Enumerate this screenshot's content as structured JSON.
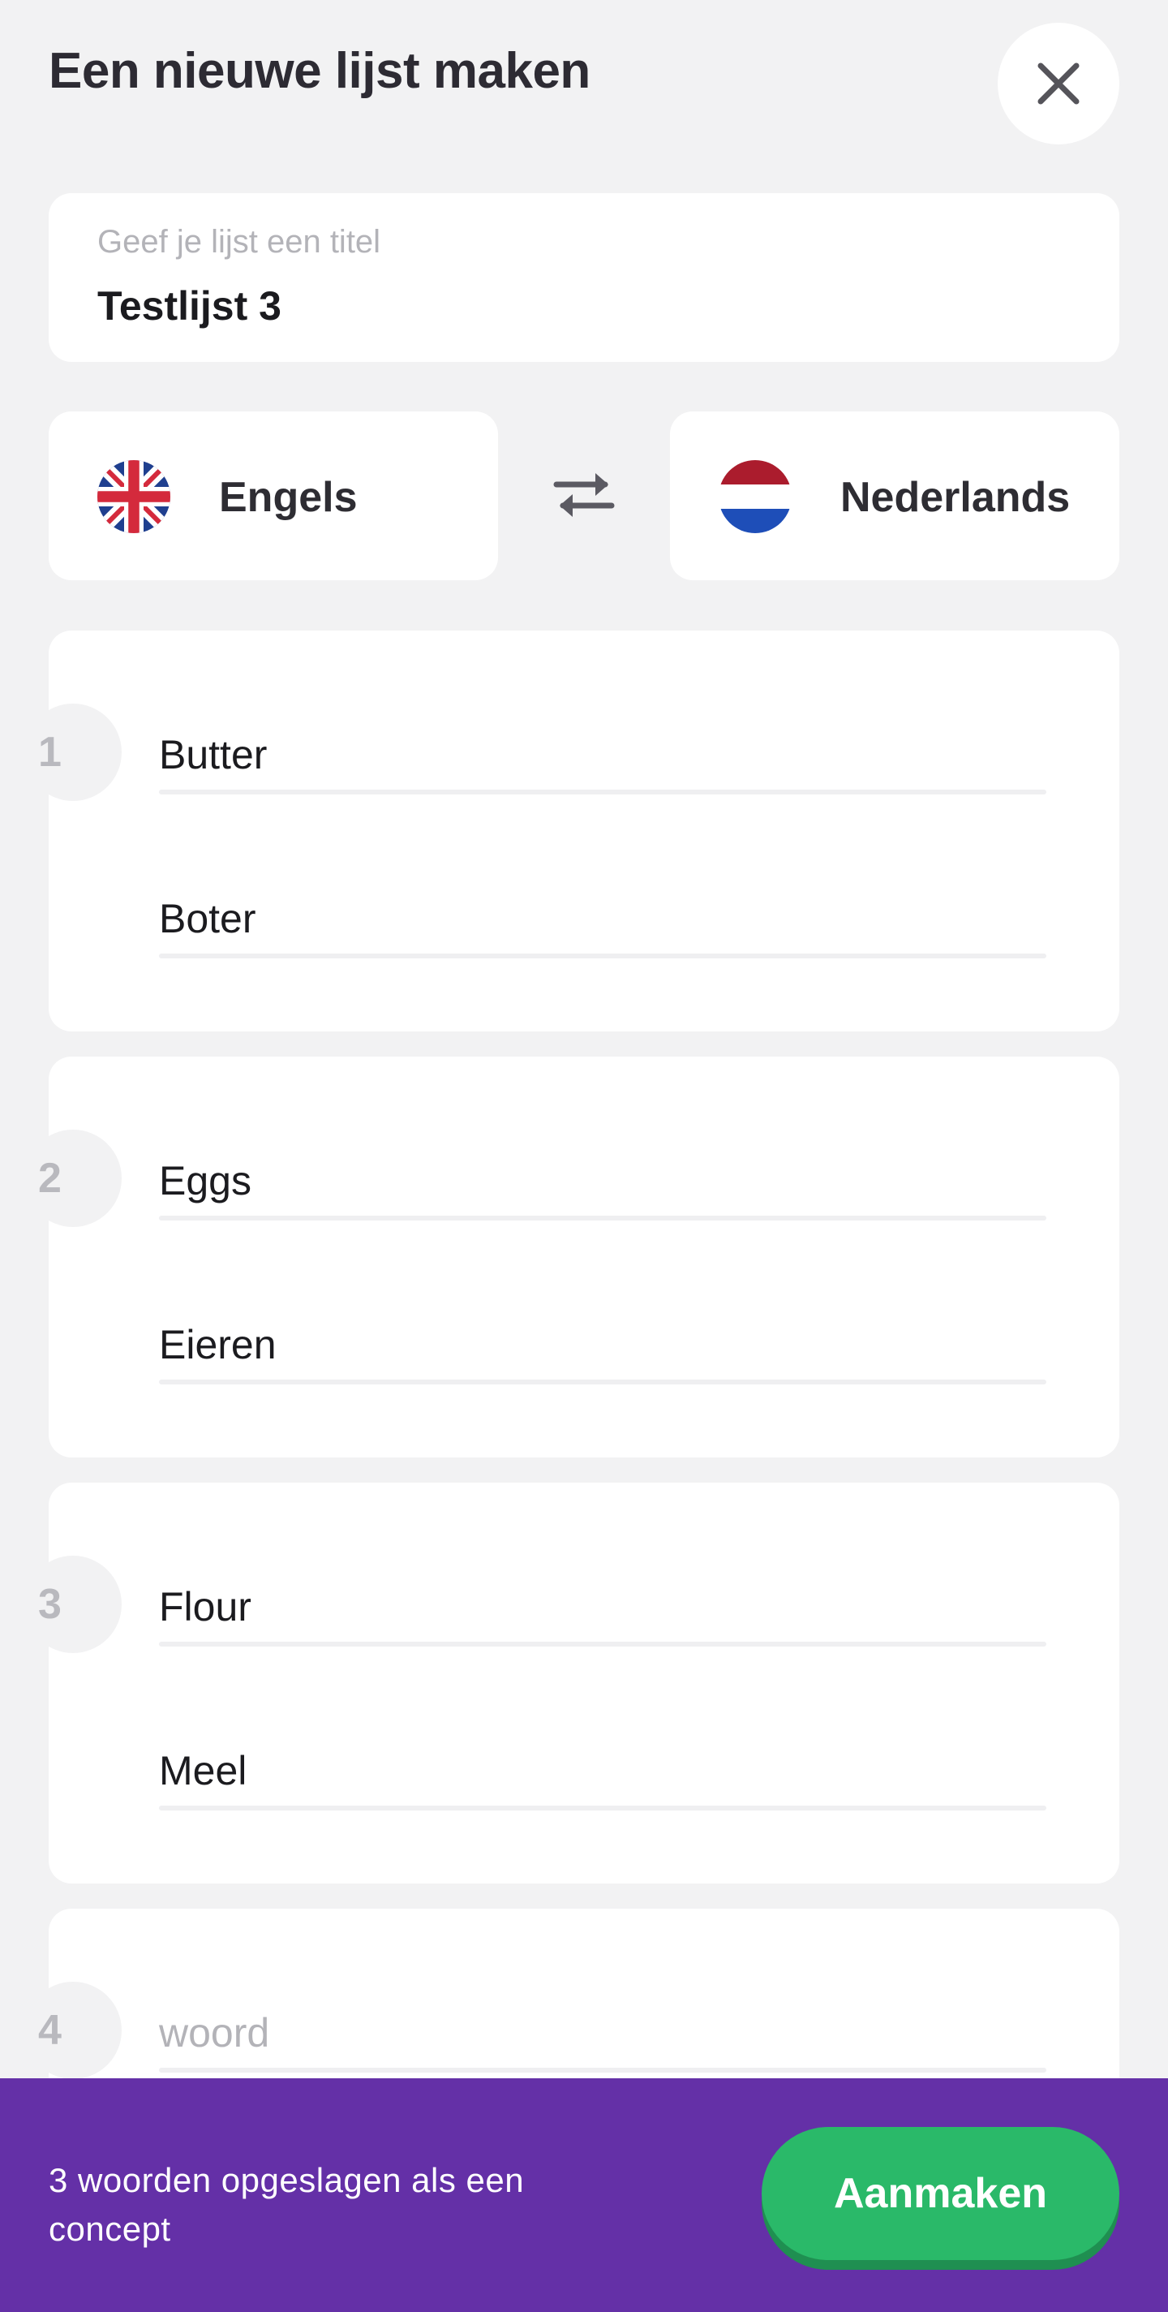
{
  "header": {
    "title": "Een nieuwe lijst maken",
    "close_icon": "close-icon"
  },
  "list_title": {
    "placeholder": "Geef je lijst een titel",
    "value": "Testlijst 3"
  },
  "languages": {
    "source": {
      "name": "Engels",
      "flag": "uk-flag-icon"
    },
    "swap_icon": "swap-arrows-icon",
    "target": {
      "name": "Nederlands",
      "flag": "nl-flag-icon"
    }
  },
  "entries": [
    {
      "number": "1",
      "word": "Butter",
      "translation": "Boter"
    },
    {
      "number": "2",
      "word": "Eggs",
      "translation": "Eieren"
    },
    {
      "number": "3",
      "word": "Flour",
      "translation": "Meel"
    },
    {
      "number": "4",
      "word_placeholder": "woord"
    }
  ],
  "footer": {
    "status": "3 woorden opgeslagen als een concept",
    "create_label": "Aanmaken"
  },
  "colors": {
    "background": "#f2f2f3",
    "footer": "#6430a7",
    "create_button": "#2ab969"
  }
}
